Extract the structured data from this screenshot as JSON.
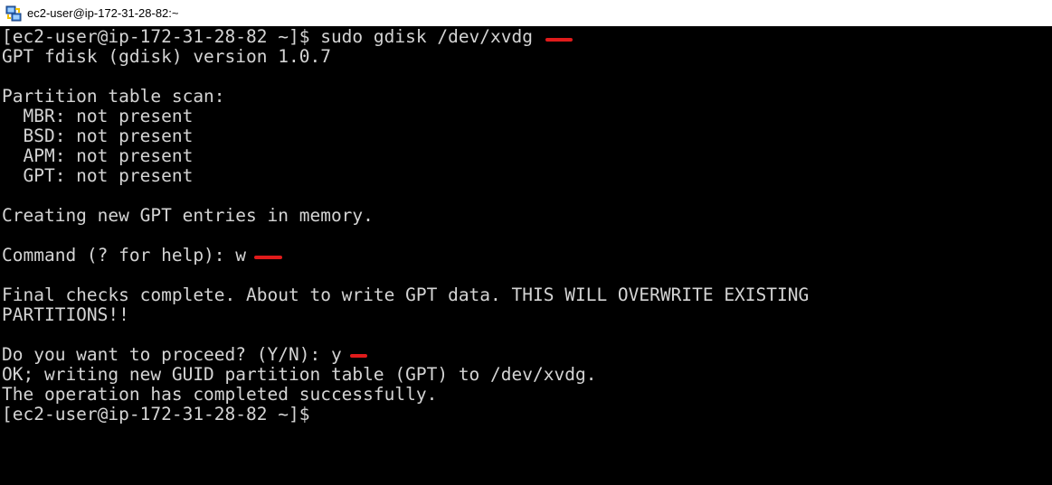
{
  "window": {
    "title": "ec2-user@ip-172-31-28-82:~",
    "icon": "putty-icon"
  },
  "terminal": {
    "background": "#000000",
    "foreground": "#d4d4d4",
    "marker_color": "#e01b1b",
    "lines": [
      "[ec2-user@ip-172-31-28-82 ~]$ sudo gdisk /dev/xvdg",
      "GPT fdisk (gdisk) version 1.0.7",
      "",
      "Partition table scan:",
      "  MBR: not present",
      "  BSD: not present",
      "  APM: not present",
      "  GPT: not present",
      "",
      "Creating new GPT entries in memory.",
      "",
      "Command (? for help): w",
      "",
      "Final checks complete. About to write GPT data. THIS WILL OVERWRITE EXISTING",
      "PARTITIONS!!",
      "",
      "Do you want to proceed? (Y/N): y",
      "OK; writing new GUID partition table (GPT) to /dev/xvdg.",
      "The operation has completed successfully.",
      "[ec2-user@ip-172-31-28-82 ~]$"
    ]
  }
}
